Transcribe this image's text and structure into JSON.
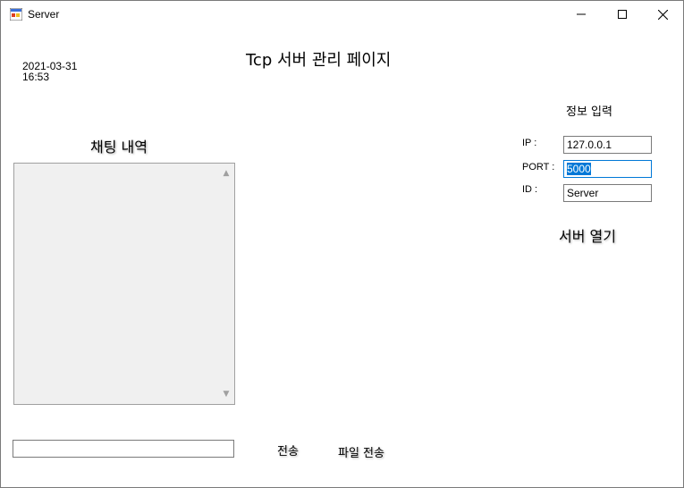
{
  "window": {
    "title": "Server"
  },
  "header": {
    "page_title": "Tcp 서버 관리 페이지",
    "date": "2021-03-31",
    "time": "16:53"
  },
  "chat": {
    "title": "채팅 내역",
    "input_value": ""
  },
  "actions": {
    "send_label": "전송",
    "file_send_label": "파일 전송"
  },
  "info": {
    "title": "정보 입력",
    "ip_label": "IP :",
    "ip_value": "127.0.0.1",
    "port_label": "PORT :",
    "port_value": "5000",
    "id_label": "ID :",
    "id_value": "Server",
    "open_server_label": "서버 열기"
  },
  "icons": {
    "minimize": "minimize-icon",
    "maximize": "maximize-icon",
    "close": "close-icon",
    "app": "form-app-icon"
  }
}
